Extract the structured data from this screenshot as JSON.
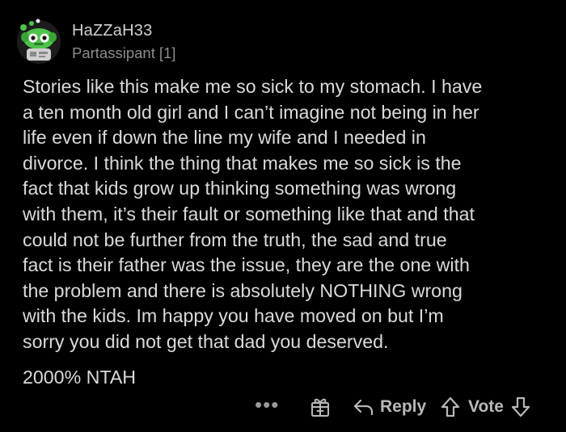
{
  "comment": {
    "author": "HaZZaH33",
    "flair": "Partassipant",
    "flair_count": "[1]",
    "body_lines": [
      "Stories like this make me so sick to my stomach. I have",
      "a ten month old girl and I can’t imagine not being in her",
      "life even if down the line my wife and I needed in",
      "divorce. I think the thing that makes me so sick is the",
      "fact that kids grow up thinking something was wrong",
      "with them, it’s their fault or something like that and that",
      "could not be further from the truth, the sad and true",
      "fact is their father was the issue, they are the one with",
      "the problem and there is absolutely NOTHING wrong",
      "with the kids. Im happy you have moved on but I’m",
      "sorry you did not get that dad you deserved."
    ],
    "verdict": "2000% NTAH"
  },
  "actions": {
    "more_label": "•••",
    "reply_label": "Reply",
    "vote_label": "Vote"
  },
  "icons": {
    "more": "more-options-icon",
    "award": "gift-award-icon",
    "reply": "reply-arrow-icon",
    "upvote": "upvote-arrow-icon",
    "downvote": "downvote-arrow-icon"
  },
  "colors": {
    "background": "#000000",
    "text": "#dadada",
    "secondary_text": "#8c8c8c",
    "action_text": "#b8b8b8",
    "avatar_green": "#4fc24a"
  }
}
